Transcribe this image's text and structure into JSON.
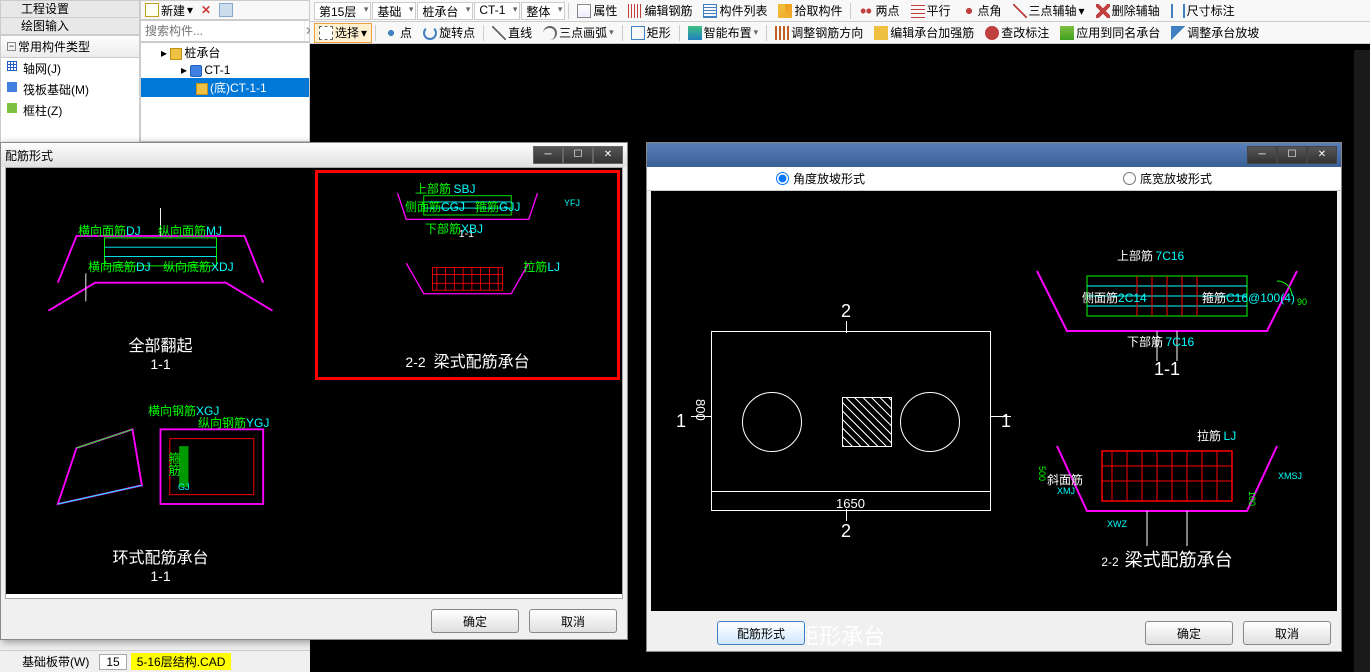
{
  "leftTabs": {
    "tab1": "工程设置",
    "tab2": "绘图输入"
  },
  "newToolbar": {
    "new": "新建",
    "dropdown": "▾"
  },
  "search": {
    "placeholder": "搜索构件..."
  },
  "tree": {
    "root": "桩承台",
    "l2": "CT-1",
    "l3": "(底)CT-1-1"
  },
  "sidebar": {
    "header": "常用构件类型",
    "items": [
      "轴网(J)",
      "筏板基础(M)",
      "框柱(Z)"
    ]
  },
  "toolbar1": {
    "floor": "第15层",
    "cat": "基础",
    "sub": "桩承台",
    "item": "CT-1",
    "whole": "整体",
    "prop": "属性",
    "editRebar": "编辑钢筋",
    "list": "构件列表",
    "pick": "拾取构件",
    "twoPt": "两点",
    "parallel": "平行",
    "ptAngle": "点角",
    "threePt": "三点辅轴",
    "delAux": "删除辅轴",
    "dim": "尺寸标注"
  },
  "toolbar2": {
    "select": "选择",
    "point": "点",
    "rotPoint": "旋转点",
    "line": "直线",
    "arc": "三点画弧",
    "rect": "矩形",
    "smart": "智能布置",
    "adjDir": "调整钢筋方向",
    "editCap": "编辑承台加强筋",
    "check": "查改标注",
    "apply": "应用到同名承台",
    "slope": "调整承台放坡"
  },
  "dialog1": {
    "title": "配筋形式",
    "cells": {
      "c1": {
        "label": "全部翻起",
        "sub": "1-1",
        "hx": "横向面筋",
        "zx": "纵向面筋",
        "hxd": "横向底筋",
        "zxd": "纵向底筋",
        "dj": "DJ",
        "mj": "MJ",
        "xdj": "XDJ"
      },
      "c2": {
        "label": "梁式配筋承台",
        "sub": "2-2",
        "sub1": "1-1",
        "sbj": "上部筋",
        "sbjv": "SBJ",
        "cmj": "侧面筋",
        "cgj": "CGJ",
        "gj": "箍筋",
        "gjj": "GJJ",
        "xbj": "下部筋",
        "xbjv": "XBJ",
        "lj": "拉筋",
        "ljv": "LJ",
        "yfj": "YFJ"
      },
      "c3": {
        "label": "环式配筋承台",
        "sub": "1-1",
        "hxgj": "横向钢筋",
        "xgj": "XGJ",
        "zxgj": "纵向钢筋",
        "ygj": "YGJ",
        "gj": "箍筋",
        "gjv": "GJ"
      }
    },
    "ok": "确定",
    "cancel": "取消"
  },
  "dialog2": {
    "radio1": "角度放坡形式",
    "radio2": "底宽放坡形式",
    "left": {
      "title": "矩形承台",
      "w": "1650",
      "h": "800",
      "n1": "1",
      "n2": "2"
    },
    "right": {
      "sec1": {
        "label": "1-1",
        "sbj": "上部筋",
        "sbjv": "7C16",
        "cmj": "侧面筋",
        "cmjv": "2C14",
        "gj": "箍筋",
        "gjv": "C16@100(4)",
        "xbj": "下部筋",
        "xbjv": "7C16",
        "ang": "90"
      },
      "sec2": {
        "label": "2-2",
        "title": "梁式配筋承台",
        "xmj": "斜面筋",
        "xmjv": "XMJ",
        "xmsj": "XMSJ",
        "lj": "拉筋",
        "ljv": "LJ",
        "xwz": "XWZ",
        "h": "500",
        "d": "100"
      }
    },
    "rebarForm": "配筋形式",
    "ok": "确定",
    "cancel": "取消"
  },
  "bottom": {
    "item": "基础板带(W)",
    "num": "15",
    "cad": "5-16层结构.CAD"
  },
  "canvasMarkers": {
    "m1": "2",
    "m2": "80"
  }
}
